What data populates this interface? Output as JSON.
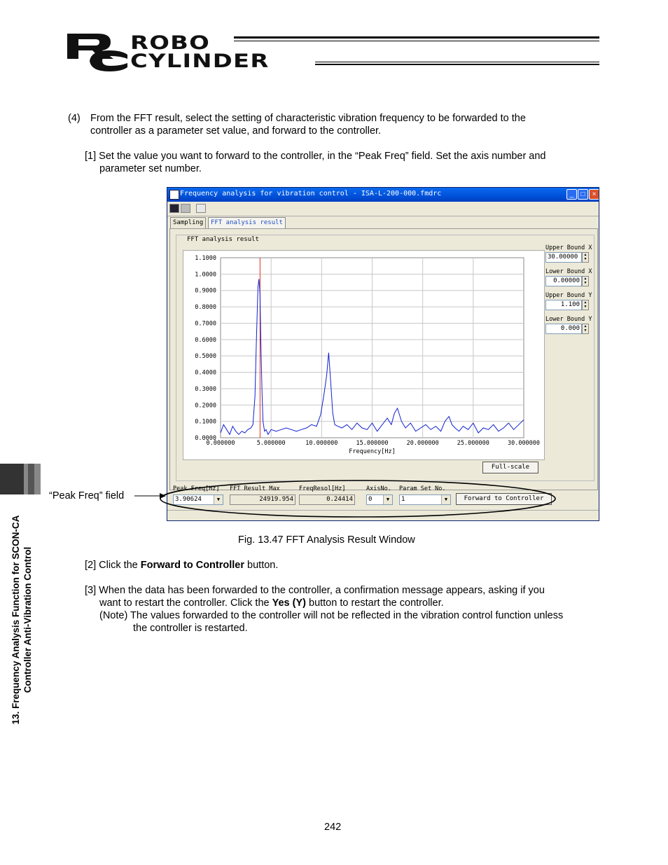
{
  "header": {
    "logo_line1": "ROBO",
    "logo_line2": "CYLINDER"
  },
  "intro": {
    "item_number": "(4)",
    "line1": "From the FFT result, select the setting of characteristic vibration frequency to be forwarded to the",
    "line2": "controller as a parameter set value, and forward to the controller."
  },
  "step1": {
    "line1": "[1] Set the value you want to forward to the controller, in the “Peak Freq” field. Set the axis number and",
    "line2": "parameter set number."
  },
  "window": {
    "title": "Frequency analysis for vibration control - ISA-L-200-000.fmdrc",
    "tabs": [
      "Sampling",
      "FFT analysis result"
    ],
    "groupbox_title": "FFT analysis result",
    "bounds": [
      {
        "label": "Upper Bound X",
        "value": "30.00000"
      },
      {
        "label": "Lower Bound X",
        "value": "0.00000"
      },
      {
        "label": "Upper Bound Y",
        "value": "1.100"
      },
      {
        "label": "Lower Bound Y",
        "value": "0.000"
      }
    ],
    "full_scale_button": "Full-scale",
    "bottom_fields": {
      "peak_freq_label": "Peak Freq[Hz]",
      "peak_freq_value": "3.90624",
      "fft_max_label": "FFT Result Max",
      "fft_max_value": "24919.954",
      "freq_resol_label": "FreqResol[Hz]",
      "freq_resol_value": "0.24414",
      "axis_no_label": "AxisNo.",
      "axis_no_value": "0",
      "param_set_label": "Param Set No.",
      "param_set_value": "1",
      "forward_button": "Forward to Controller"
    }
  },
  "chart_data": {
    "type": "line",
    "xlabel": "Frequency[Hz]",
    "ylabel": "",
    "xlim": [
      0,
      30
    ],
    "ylim": [
      0,
      1.1
    ],
    "x_ticks": [
      "0.000000",
      "5.000000",
      "10.000000",
      "15.000000",
      "20.000000",
      "25.000000",
      "30.000000"
    ],
    "y_ticks": [
      "0.0000",
      "0.1000",
      "0.2000",
      "0.3000",
      "0.4000",
      "0.5000",
      "0.6000",
      "0.7000",
      "0.8000",
      "0.9000",
      "1.0000",
      "1.1000"
    ],
    "grid": true,
    "peak_marker_x": 3.90624,
    "line_color": "#1020d0",
    "marker_color": "#e03020",
    "series": [
      {
        "x": [
          0,
          0.3,
          0.6,
          0.9,
          1.2,
          1.5,
          1.8,
          2.1,
          2.4,
          2.7,
          3.0,
          3.2,
          3.4,
          3.55,
          3.7,
          3.8,
          3.9,
          4.0,
          4.1,
          4.2,
          4.35,
          4.5,
          4.7,
          5.0,
          5.5,
          6.0,
          6.5,
          7.0,
          7.5,
          8.0,
          8.5,
          9.0,
          9.5,
          9.9,
          10.2,
          10.5,
          10.7,
          10.9,
          11.1,
          11.3,
          11.6,
          12.0,
          12.5,
          13.0,
          13.5,
          14.0,
          14.5,
          15.0,
          15.5,
          16.0,
          16.5,
          16.9,
          17.2,
          17.5,
          17.9,
          18.3,
          18.8,
          19.3,
          19.8,
          20.3,
          20.8,
          21.3,
          21.8,
          22.2,
          22.6,
          22.9,
          23.2,
          23.6,
          24.0,
          24.5,
          25.0,
          25.5,
          26.0,
          26.5,
          27.0,
          27.5,
          28.0,
          28.5,
          29.0,
          29.5,
          30.0
        ],
        "y": [
          0.03,
          0.08,
          0.05,
          0.02,
          0.07,
          0.04,
          0.02,
          0.04,
          0.03,
          0.05,
          0.06,
          0.08,
          0.25,
          0.6,
          0.92,
          0.97,
          0.88,
          0.55,
          0.28,
          0.1,
          0.04,
          0.05,
          0.02,
          0.05,
          0.04,
          0.05,
          0.06,
          0.05,
          0.04,
          0.05,
          0.06,
          0.08,
          0.07,
          0.14,
          0.25,
          0.38,
          0.52,
          0.34,
          0.15,
          0.08,
          0.07,
          0.06,
          0.08,
          0.05,
          0.09,
          0.06,
          0.05,
          0.09,
          0.04,
          0.08,
          0.12,
          0.08,
          0.15,
          0.18,
          0.1,
          0.06,
          0.09,
          0.04,
          0.06,
          0.08,
          0.05,
          0.07,
          0.04,
          0.1,
          0.13,
          0.08,
          0.06,
          0.04,
          0.07,
          0.05,
          0.09,
          0.03,
          0.06,
          0.05,
          0.08,
          0.04,
          0.06,
          0.09,
          0.05,
          0.08,
          0.11
        ]
      }
    ]
  },
  "callout": {
    "label": "“Peak Freq” field"
  },
  "figure_caption": "Fig. 13.47 FFT Analysis Result Window",
  "step2": {
    "prefix": "[2] Click the",
    "bold": "Forward to Controller",
    "suffix": "button."
  },
  "step3": {
    "line1": "[3] When the data has been forwarded to the controller, a confirmation message appears, asking if you",
    "line2_prefix": "want to restart the controller. Click the",
    "line2_bold": "Yes (Y)",
    "line2_suffix": "button to restart the controller.",
    "note_line1": "(Note) The values forwarded to the controller will not be reflected in the vibration control function unless",
    "note_line2": "the controller is restarted."
  },
  "side_tab": {
    "line1": "13. Frequency Analysis Function for SCON-CA",
    "line2": "Controller Anti-Vibration Control"
  },
  "page_number": "242"
}
